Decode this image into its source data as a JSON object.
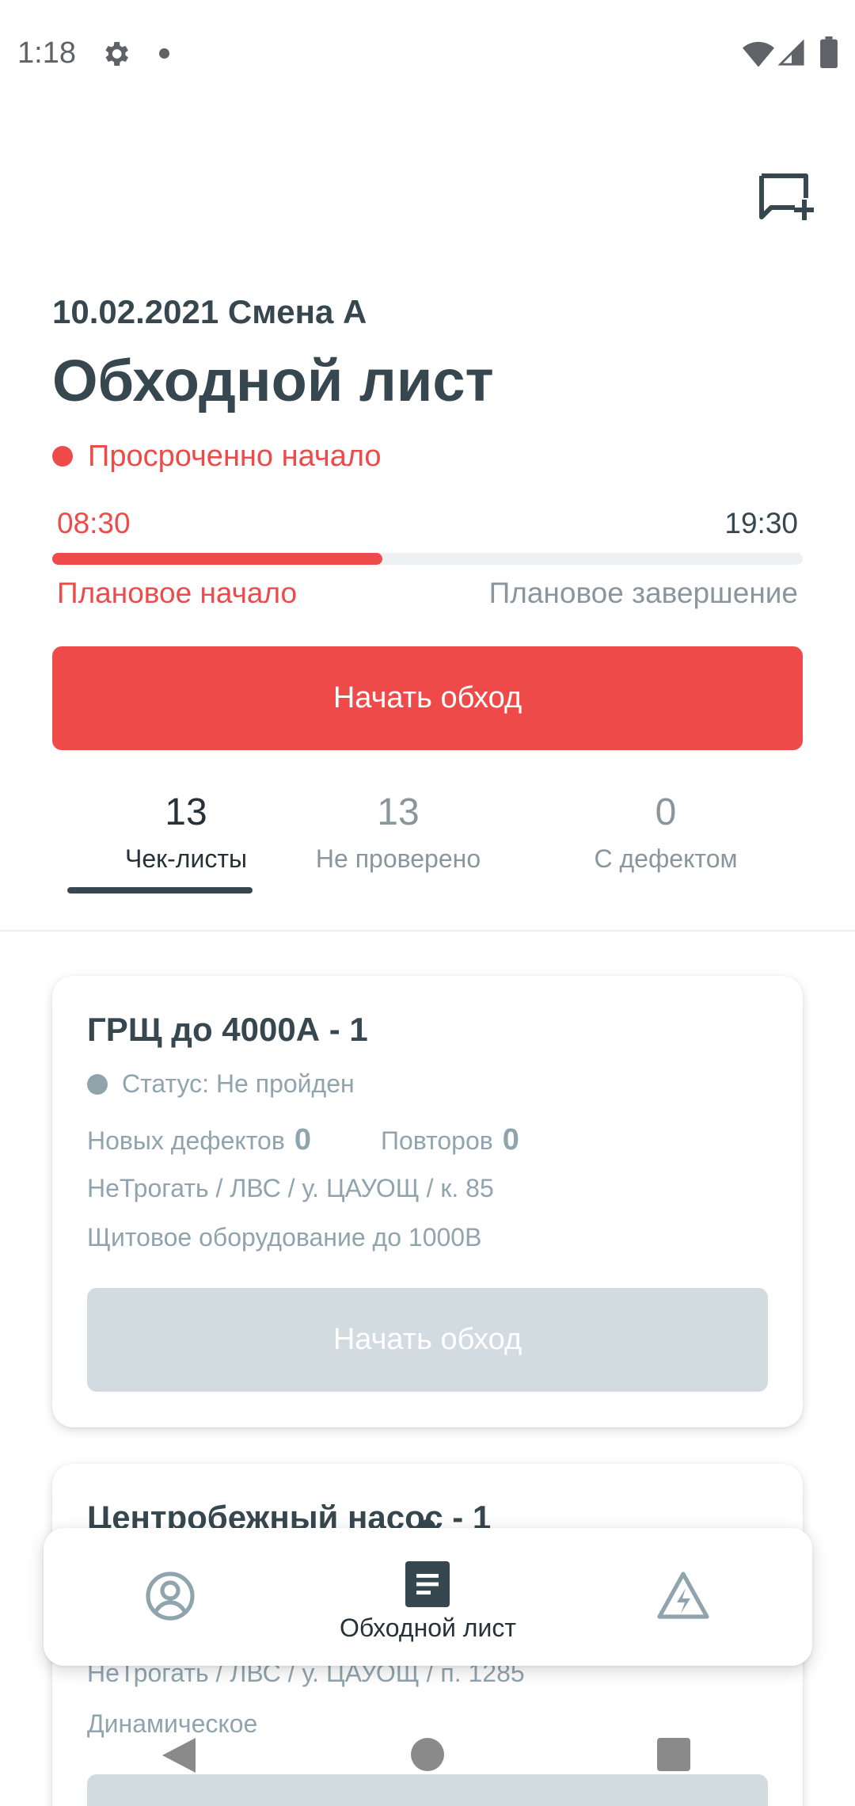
{
  "status_bar": {
    "time": "1:18",
    "icons": [
      "settings-icon",
      "notification-dot-icon",
      "wifi-icon",
      "signal-icon",
      "battery-icon"
    ]
  },
  "header": {
    "action_icon": "add-comment-icon"
  },
  "sheet": {
    "shift_title": "10.02.2021 Смена А",
    "title": "Обходной лист",
    "status": "Просроченно начало",
    "start_time": "08:30",
    "end_time": "19:30",
    "start_label": "Плановое начало",
    "end_label": "Плановое завершение",
    "progress_fraction": 0.44,
    "start_button": "Начать обход"
  },
  "tabs": [
    {
      "count": "13",
      "label": "Чек-листы",
      "active": true
    },
    {
      "count": "13",
      "label": "Не проверено",
      "active": false
    },
    {
      "count": "0",
      "label": "С дефектом",
      "active": false
    }
  ],
  "cards": [
    {
      "title": "ГРЩ до 4000А - 1",
      "status": "Статус: Не пройден",
      "new_defects_label": "Новых дефектов",
      "new_defects": "0",
      "repeats_label": "Повторов",
      "repeats": "0",
      "path": "НеТрогать / ЛВС / у. ЦАУОЩ / к. 85",
      "type": "Щитовое оборудование до 1000В",
      "button": "Начать обход"
    },
    {
      "title": "Центробежный насос - 1",
      "path": "НеТрогать / ЛВС / у. ЦАУОЩ / п. 1285",
      "type": "Динамическое"
    }
  ],
  "bottom_nav": {
    "items": [
      {
        "icon": "profile-icon",
        "label": ""
      },
      {
        "icon": "sheet-icon",
        "label": "Обходной лист"
      },
      {
        "icon": "warning-icon",
        "label": ""
      }
    ]
  },
  "colors": {
    "accent": "#ef4a4a",
    "text_dark": "#37474f",
    "text_muted": "#90a4ae",
    "disabled_button": "#d1dbe0"
  }
}
